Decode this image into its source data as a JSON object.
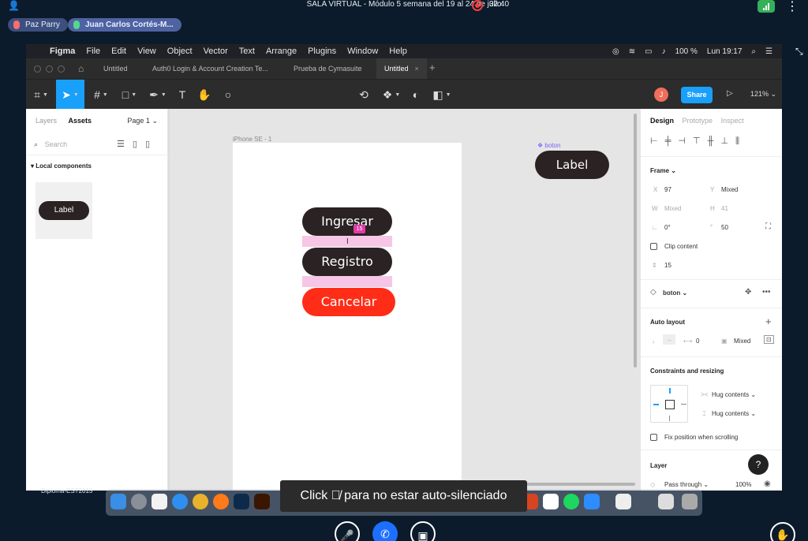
{
  "meeting": {
    "title": "SALA VIRTUAL - Módulo 5 semana del 19 al 24 de julio",
    "record_time": "32:40",
    "participants": [
      {
        "name": "Paz Parry"
      },
      {
        "name": "Juan Carlos Cortés-M..."
      }
    ],
    "toast": {
      "before": "Click",
      "after": "para no estar auto-silenciado"
    },
    "controls": [
      "mic-off-icon",
      "phone-icon",
      "camera-off-icon"
    ]
  },
  "mac_menu": {
    "app": "Figma",
    "items": [
      "File",
      "Edit",
      "View",
      "Object",
      "Vector",
      "Text",
      "Arrange",
      "Plugins",
      "Window",
      "Help"
    ],
    "battery": "100 %",
    "clock": "Lun 19:17"
  },
  "figma": {
    "tabs": [
      {
        "label": "Untitled"
      },
      {
        "label": "Auth0 Login & Account Creation Te..."
      },
      {
        "label": "Prueba de Cymasuite"
      },
      {
        "label": "Untitled",
        "active": true
      }
    ],
    "avatar_initial": "J",
    "share_label": "Share",
    "zoom": "121%",
    "left_panel": {
      "tab_layers": "Layers",
      "tab_assets": "Assets",
      "page": "Page 1",
      "search_placeholder": "Search",
      "section": "Local components",
      "component_thumb_label": "Label"
    },
    "canvas": {
      "frame_name": "iPhone SE - 1",
      "buttons": [
        "Ingresar",
        "Registro",
        "Cancelar"
      ],
      "gap_value": "15",
      "component_name": "boton",
      "component_label": "Label"
    },
    "right_panel": {
      "tabs": [
        "Design",
        "Prototype",
        "Inspect"
      ],
      "frame_header": "Frame",
      "x_label": "X",
      "x_value": "97",
      "y_label": "Y",
      "y_value": "Mixed",
      "w_label": "W",
      "w_value": "Mixed",
      "h_label": "H",
      "h_value": "41",
      "rotation": "0°",
      "radius": "50",
      "clip_content": "Clip content",
      "spacing": "15",
      "component_name": "boton",
      "auto_layout": "Auto layout",
      "auto_spacing": "0",
      "auto_padding": "Mixed",
      "constraints_header": "Constraints and resizing",
      "hug_h": "Hug contents",
      "hug_v": "Hug contents",
      "fix_position": "Fix position when scrolling",
      "layer_header": "Layer",
      "blend_mode": "Pass through",
      "opacity": "100%"
    }
  },
  "desktop_label": "Diploma-EST2015",
  "colors": {
    "accent": "#18a0fb",
    "dark_button": "#2a2223",
    "cancel_button": "#ff2d17",
    "gap_highlight": "#f7c6e6"
  }
}
